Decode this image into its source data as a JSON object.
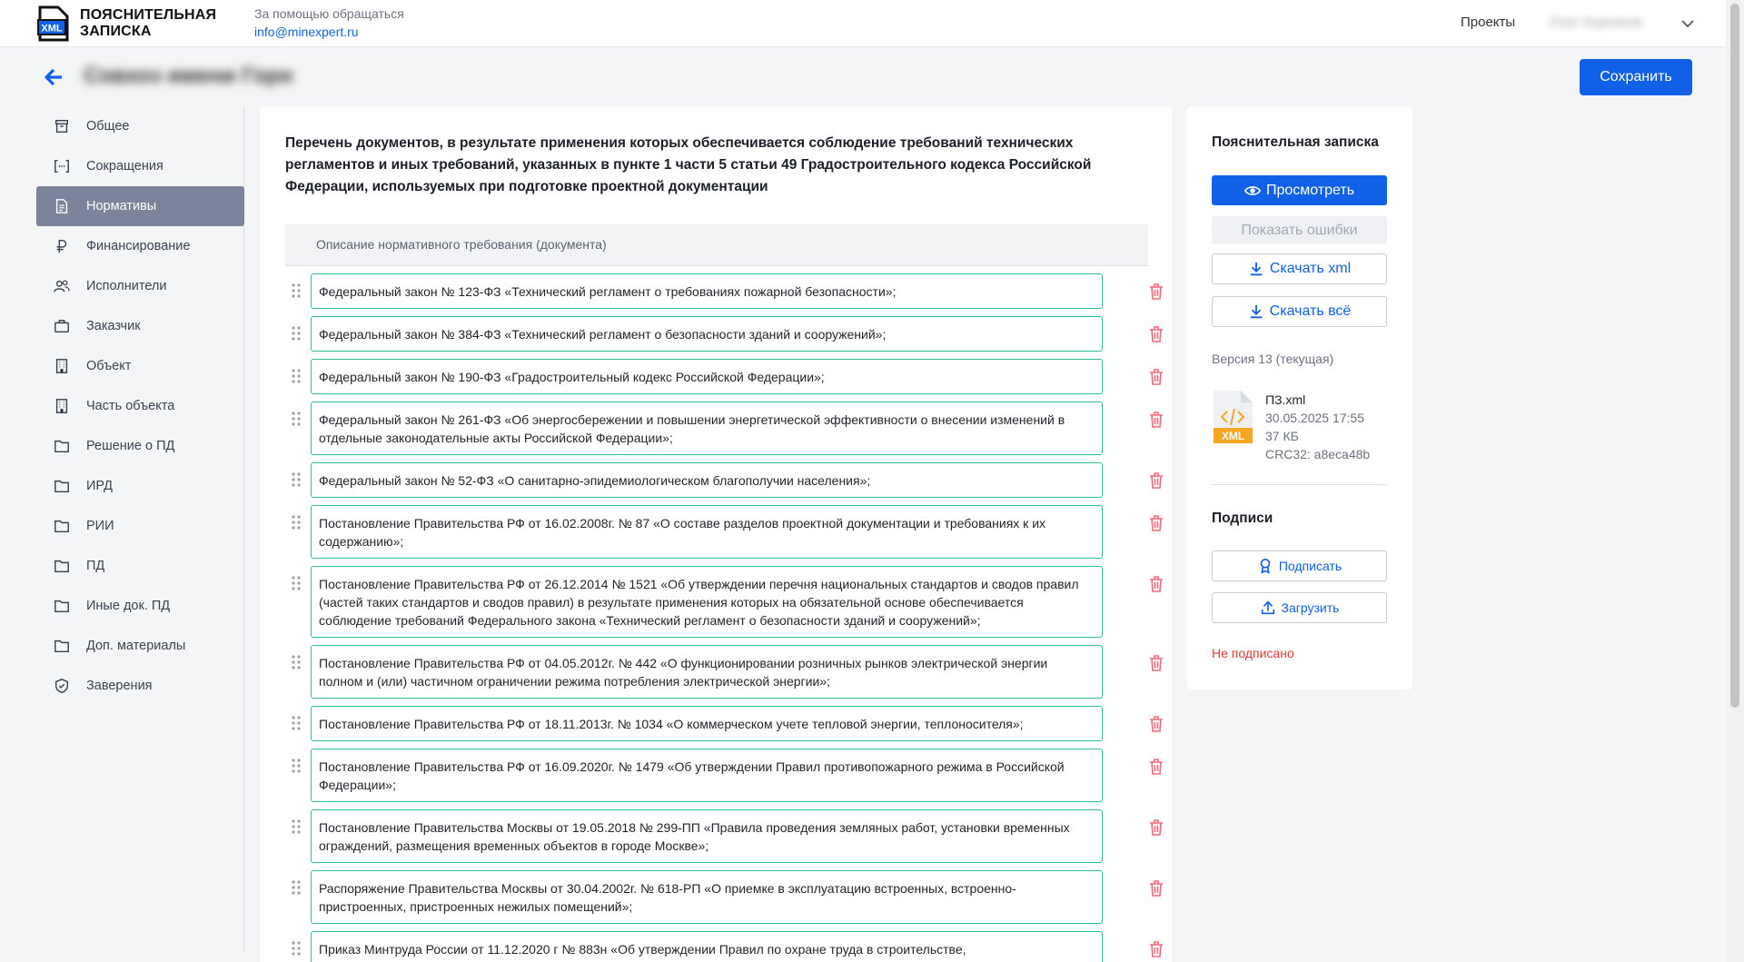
{
  "header": {
    "logo_line1": "ПОЯСНИТЕЛЬНАЯ",
    "logo_line2": "ЗАПИСКА",
    "logo_badge": "XML",
    "help_text": "За помощью обращаться",
    "help_email": "info@minexpert.ru",
    "nav_projects": "Проекты",
    "user_name": "Олег Корняков"
  },
  "page": {
    "project_title": "Совхоз имени Горн",
    "save_label": "Сохранить"
  },
  "sidebar": {
    "items": [
      {
        "label": "Общее",
        "icon": "archive-icon",
        "active": false
      },
      {
        "label": "Сокращения",
        "icon": "brackets-icon",
        "active": false
      },
      {
        "label": "Нормативы",
        "icon": "document-icon",
        "active": true
      },
      {
        "label": "Финансирование",
        "icon": "ruble-icon",
        "active": false
      },
      {
        "label": "Исполнители",
        "icon": "users-icon",
        "active": false
      },
      {
        "label": "Заказчик",
        "icon": "briefcase-icon",
        "active": false
      },
      {
        "label": "Объект",
        "icon": "building-icon",
        "active": false
      },
      {
        "label": "Часть объекта",
        "icon": "building-icon",
        "active": false
      },
      {
        "label": "Решение о ПД",
        "icon": "folder-icon",
        "active": false
      },
      {
        "label": "ИРД",
        "icon": "folder-icon",
        "active": false
      },
      {
        "label": "РИИ",
        "icon": "folder-icon",
        "active": false
      },
      {
        "label": "ПД",
        "icon": "folder-icon",
        "active": false
      },
      {
        "label": "Иные док. ПД",
        "icon": "folder-icon",
        "active": false
      },
      {
        "label": "Доп. материалы",
        "icon": "folder-icon",
        "active": false
      },
      {
        "label": "Заверения",
        "icon": "shield-check-icon",
        "active": false
      }
    ]
  },
  "main": {
    "heading": "Перечень документов, в результате применения которых обеспечивается соблюдение требований технических регламентов и иных требований, указанных в пункте 1 части 5 статьи 49 Градостроительного кодекса Российской Федерации, используемых при подготовке проектной документации",
    "column_header": "Описание нормативного требования (документа)",
    "rows": [
      "Федеральный закон № 123-ФЗ «Технический регламент о требованиях пожарной безопасности»;",
      "Федеральный закон № 384-ФЗ «Технический регламент о безопасности зданий и сооружений»;",
      "Федеральный закон № 190-ФЗ «Градостроительный кодекс Российской Федерации»;",
      "Федеральный закон № 261-ФЗ «Об энергосбережении и повышении энергетической эффективности о внесении изменений в отдельные законодательные акты Российской Федерации»;",
      "Федеральный закон № 52-ФЗ «О санитарно-эпидемиологическом благополучии населения»;",
      "Постановление Правительства РФ от 16.02.2008г. № 87 «О составе разделов проектной документации и требованиях к их содержанию»;",
      "Постановление Правительства РФ от 26.12.2014 № 1521 «Об утверждении перечня национальных стандартов и сводов правил (частей таких стандартов и сводов правил) в результате применения которых на обязательной основе обеспечивается соблюдение требований Федерального закона «Технический регламент о безопасности зданий и сооружений»;",
      "Постановление Правительства РФ от 04.05.2012г. № 442 «О функционировании розничных рынков электрической энергии полном и (или) частичном ограничении режима потребления электрической энергии»;",
      "Постановление Правительства РФ от 18.11.2013г. № 1034 «О коммерческом учете тепловой энергии, теплоносителя»;",
      "Постановление Правительства РФ от 16.09.2020г. № 1479 «Об утверждении Правил противопожарного режима в Российской Федерации»;",
      "Постановление Правительства Москвы от 19.05.2018 № 299-ПП «Правила проведения земляных работ, установки временных ограждений, размещения временных объектов в городе Москве»;",
      "Распоряжение Правительства Москвы от 30.04.2002г. № 618-РП «О приемке в эксплуатацию встроенных, встроенно-пристроенных, пристроенных нежилых помещений»;",
      "Приказ Минтруда России от 11.12.2020 г № 883н «Об утверждении Правил по охране труда в строительстве,"
    ]
  },
  "panel": {
    "title": "Пояснительная записка",
    "preview_label": "Просмотреть",
    "errors_label": "Показать ошибки",
    "download_xml_label": "Скачать xml",
    "download_all_label": "Скачать всё",
    "version_label": "Версия 13 (текущая)",
    "file": {
      "badge": "XML",
      "name": "ПЗ.xml",
      "date": "30.05.2025 17:55",
      "size": "37 КБ",
      "crc": "CRC32: a8eca48b"
    },
    "signatures_title": "Подписи",
    "sign_label": "Подписать",
    "upload_label": "Загрузить",
    "status": "Не подписано"
  },
  "colors": {
    "accent": "#1160e8",
    "row_border": "#30c28a",
    "danger": "#e53935",
    "sidebar_active": "#7b849a"
  }
}
